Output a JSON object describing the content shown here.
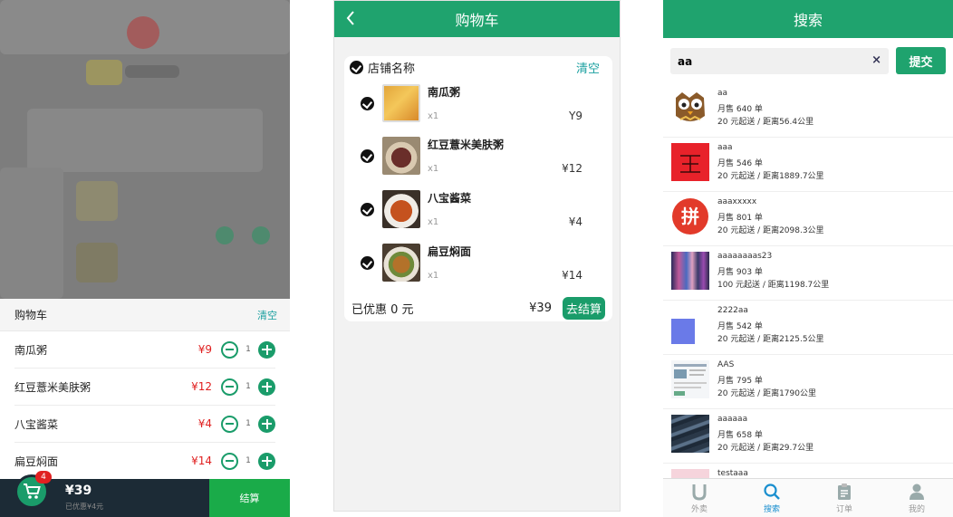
{
  "screen1": {
    "cart_title": "购物车",
    "clear_label": "清空",
    "items": [
      {
        "name": "南瓜粥",
        "price": "¥9",
        "qty": "1"
      },
      {
        "name": "红豆薏米美肤粥",
        "price": "¥12",
        "qty": "1"
      },
      {
        "name": "八宝酱菜",
        "price": "¥4",
        "qty": "1"
      },
      {
        "name": "扁豆焖面",
        "price": "¥14",
        "qty": "1"
      }
    ],
    "badge_count": "4",
    "total": "¥39",
    "discount_note": "已优惠¥4元",
    "settle_label": "结算"
  },
  "screen2": {
    "title": "购物车",
    "shop_name": "店铺名称",
    "clear_label": "清空",
    "items": [
      {
        "name": "南瓜粥",
        "qty": "x1",
        "price": "Y9"
      },
      {
        "name": "红豆薏米美肤粥",
        "qty": "x1",
        "price": "¥12"
      },
      {
        "name": "八宝酱菜",
        "qty": "x1",
        "price": "¥4"
      },
      {
        "name": "扁豆焖面",
        "qty": "x1",
        "price": "¥14"
      }
    ],
    "discount": "已优惠 0 元",
    "total": "¥39",
    "checkout_label": "去结算"
  },
  "screen3": {
    "title": "搜索",
    "search_value": "aa",
    "clear_icon": "×",
    "submit_label": "提交",
    "results": [
      {
        "name": "aa",
        "sales": "月售 640 单",
        "info": "20 元起送 / 距离56.4公里"
      },
      {
        "name": "aaa",
        "sales": "月售 546 单",
        "info": "20 元起送 / 距离1889.7公里"
      },
      {
        "name": "aaaxxxxx",
        "sales": "月售 801 单",
        "info": "20 元起送 / 距离2098.3公里"
      },
      {
        "name": "aaaaaaaas23",
        "sales": "月售 903 单",
        "info": "100 元起送 / 距离1198.7公里"
      },
      {
        "name": "2222aa",
        "sales": "月售 542 单",
        "info": "20 元起送 / 距离2125.5公里"
      },
      {
        "name": "AAS",
        "sales": "月售 795 单",
        "info": "20 元起送 / 距离1790公里"
      },
      {
        "name": "aaaaaa",
        "sales": "月售 658 单",
        "info": "20 元起送 / 距离29.7公里"
      },
      {
        "name": "testaaa",
        "sales": "",
        "info": ""
      }
    ],
    "tabs": [
      {
        "label": "外卖",
        "icon": "u-logo-icon"
      },
      {
        "label": "搜索",
        "icon": "search-icon"
      },
      {
        "label": "订单",
        "icon": "clipboard-icon"
      },
      {
        "label": "我的",
        "icon": "user-icon"
      }
    ],
    "active_tab": "搜索",
    "accent_color": "#1fa36e"
  }
}
